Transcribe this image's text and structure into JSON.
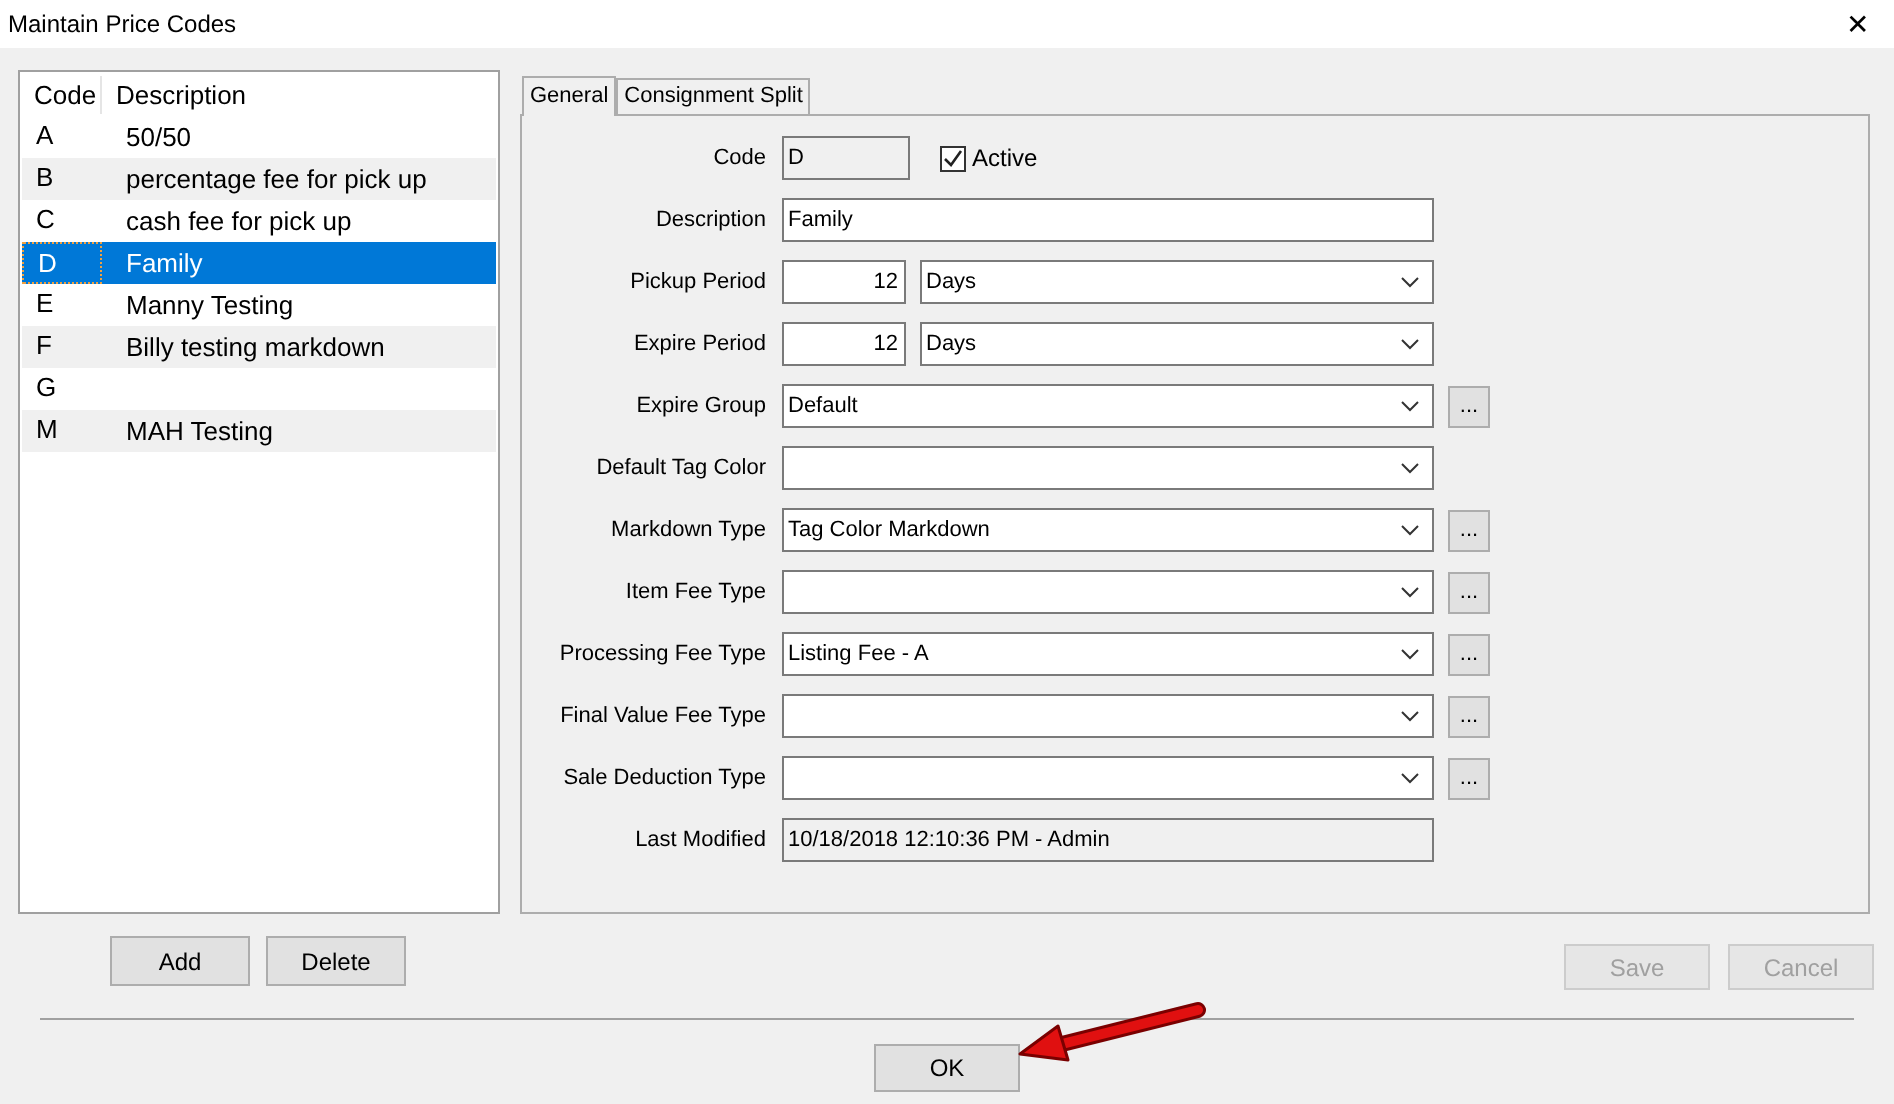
{
  "window": {
    "title": "Maintain Price Codes",
    "close": "✕"
  },
  "list": {
    "columns": [
      "Code",
      "Description"
    ],
    "rows": [
      {
        "code": "A",
        "description": "50/50",
        "selected": false
      },
      {
        "code": "B",
        "description": "percentage fee for pick up",
        "selected": false
      },
      {
        "code": "C",
        "description": "cash fee for pick up",
        "selected": false
      },
      {
        "code": "D",
        "description": "Family",
        "selected": true
      },
      {
        "code": "E",
        "description": "Manny Testing",
        "selected": false
      },
      {
        "code": "F",
        "description": "Billy testing markdown",
        "selected": false
      },
      {
        "code": "G",
        "selected": false
      },
      {
        "code": "M",
        "description": "MAH Testing",
        "selected": false
      }
    ]
  },
  "tabs": [
    {
      "label": "General",
      "selected": true
    },
    {
      "label": "Consignment Split",
      "selected": false
    }
  ],
  "fields": [
    {
      "kind": "code",
      "label": "Code",
      "value": "D",
      "checkbox": {
        "label": "Active",
        "checked": true
      }
    },
    {
      "kind": "text",
      "label": "Description",
      "value": "Family"
    },
    {
      "kind": "period",
      "label": "Pickup Period",
      "value": "12",
      "unit": "Days"
    },
    {
      "kind": "period",
      "label": "Expire Period",
      "value": "12",
      "unit": "Days"
    },
    {
      "kind": "combo",
      "label": "Expire Group",
      "value": "Default",
      "browse": "..."
    },
    {
      "kind": "combo",
      "label": "Default Tag Color"
    },
    {
      "kind": "combo",
      "label": "Markdown Type",
      "value": "Tag Color Markdown",
      "browse": "..."
    },
    {
      "kind": "combo",
      "label": "Item Fee Type",
      "browse": "..."
    },
    {
      "kind": "combo",
      "label": "Processing Fee Type",
      "value": "Listing Fee - A",
      "browse": "..."
    },
    {
      "kind": "combo",
      "label": "Final Value Fee Type",
      "browse": "..."
    },
    {
      "kind": "combo",
      "label": "Sale Deduction Type",
      "browse": "..."
    },
    {
      "kind": "readonly",
      "label": "Last Modified",
      "value": "10/18/2018 12:10:36 PM - Admin"
    }
  ],
  "list_buttons": [
    {
      "label": "Add",
      "disabled": false
    },
    {
      "label": "Delete",
      "disabled": false
    }
  ],
  "form_buttons": [
    {
      "label": "Save",
      "disabled": true
    },
    {
      "label": "Cancel",
      "disabled": true
    }
  ],
  "ok_button": {
    "label": "OK",
    "disabled": false
  }
}
